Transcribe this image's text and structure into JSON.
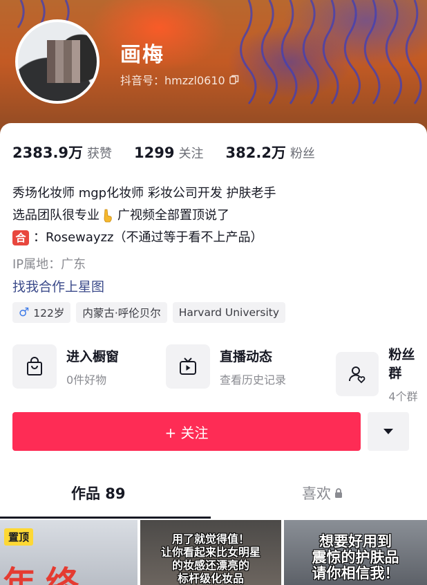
{
  "profile": {
    "name": "画梅",
    "douyin_id": "抖音号：hmzzl0610"
  },
  "stats": [
    {
      "value": "2383.9万",
      "label": "获赞"
    },
    {
      "value": "1299",
      "label": "关注"
    },
    {
      "value": "382.2万",
      "label": "粉丝"
    }
  ],
  "bio": {
    "line1": "秀场化妆师  mgp化妆师 彩妆公司开发 护肤老手",
    "line2a": "选品团队很专业",
    "line2b": "广视频全部置顶说了",
    "he_badge": "合",
    "line3": "：Rosewayzz（不通过等于看不上产品）",
    "ip": "IP属地：广东",
    "partner_link": "找我合作上星图"
  },
  "tags": [
    {
      "gender_symbol": "♂",
      "text": "122岁"
    },
    {
      "text": "内蒙古·呼伦贝尔"
    },
    {
      "text": "Harvard University"
    }
  ],
  "entries": [
    {
      "icon": "shopping-bag-icon",
      "title": "进入橱窗",
      "subtitle": "0件好物"
    },
    {
      "icon": "live-tv-icon",
      "title": "直播动态",
      "subtitle": "查看历史记录"
    },
    {
      "icon": "fans-group-icon",
      "title": "粉丝群",
      "subtitle": "4个群"
    }
  ],
  "actions": {
    "follow_label": "+ 关注"
  },
  "tabs": {
    "works": "作品 89",
    "likes": "喜欢"
  },
  "thumbs": {
    "pinned": "置顶",
    "t1_text": "年终",
    "t2_caption": [
      "用了就觉得值！",
      "让你看起来比女明星",
      "的妆感还漂亮的",
      "标杆级化妆品"
    ],
    "t3_caption": [
      "想要好用到",
      "震惊的护肤品",
      "请你相信我！"
    ]
  },
  "colors": {
    "follow": "#fe2c55",
    "link": "#3b4a8a"
  }
}
